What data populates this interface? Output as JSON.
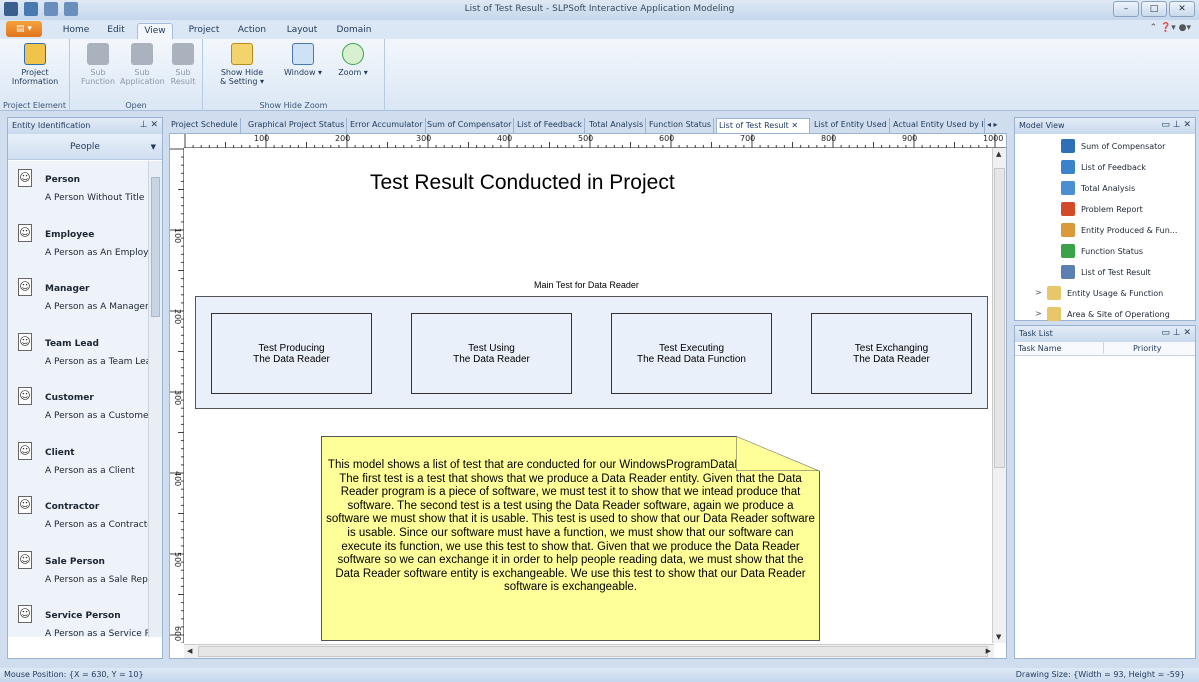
{
  "window": {
    "title": "List of Test Result - SLPSoft Interactive Application Modeling"
  },
  "ribbon": {
    "tabs": [
      "Home",
      "Edit",
      "View",
      "Project",
      "Action",
      "Layout",
      "Domain"
    ],
    "active_tab": "View",
    "groups": [
      {
        "label": "Project Element",
        "buttons": [
          {
            "label": "Project Information"
          }
        ]
      },
      {
        "label": "Open",
        "buttons": [
          {
            "label": "Sub Function"
          },
          {
            "label": "Sub Application"
          },
          {
            "label": "Sub Result"
          }
        ]
      },
      {
        "label": "Show Hide Zoom",
        "buttons": [
          {
            "label": "Show Hide & Setting"
          },
          {
            "label": "Window"
          },
          {
            "label": "Zoom"
          }
        ]
      }
    ]
  },
  "entity_panel": {
    "title": "Entity Identification",
    "category": "People",
    "items": [
      {
        "name": "Person",
        "desc": "A Person Without Title"
      },
      {
        "name": "Employee",
        "desc": "A Person as An Employee"
      },
      {
        "name": "Manager",
        "desc": "A Person as A Manager"
      },
      {
        "name": "Team Lead",
        "desc": "A Person as a Team Lead"
      },
      {
        "name": "Customer",
        "desc": "A Person as a Customer"
      },
      {
        "name": "Client",
        "desc": "A Person as a Client"
      },
      {
        "name": "Contractor",
        "desc": "A Person as a Contractor"
      },
      {
        "name": "Sale Person",
        "desc": "A Person as a Sale Rep"
      },
      {
        "name": "Service Person",
        "desc": "A Person as a Service Re"
      }
    ]
  },
  "doc_tabs": [
    "Project Schedule",
    "Graphical Project Status",
    "Error Accumulator",
    "Sum of Compensator",
    "List of Feedback",
    "Total Analysis",
    "Function Status",
    "List of Test Result",
    "List of Entity Used",
    "Actual Entity Used by I"
  ],
  "active_doc_tab": "List of Test Result",
  "ruler": {
    "h_labels": [
      "100",
      "200",
      "300",
      "400",
      "500",
      "600",
      "700",
      "800",
      "900",
      "1000"
    ],
    "v_labels": [
      "100",
      "200",
      "300",
      "400",
      "500",
      "600"
    ]
  },
  "diagram": {
    "title": "Test Result Conducted in Project",
    "group_label": "Main Test for Data Reader",
    "tests": [
      {
        "line1": "Test Producing",
        "line2": "The Data Reader"
      },
      {
        "line1": "Test Using",
        "line2": "The Data Reader"
      },
      {
        "line1": "Test Executing",
        "line2": "The Read Data Function"
      },
      {
        "line1": "Test Exchanging",
        "line2": "The Data Reader"
      }
    ],
    "note": "This model shows a list of test that are conducted for our WindowsProgramDataReader project.  The first test is a test that shows that we produce a Data Reader entity.  Given that the Data Reader program is a piece of software, we must test it to show that we intead produce that software.  The second test is a test using the Data Reader software, again we produce a software we must show that it is usable.  This test is used to show that our Data Reader software is usable.  Since our software must have a function, we must show that our software can execute its function, we use this test to show that.  Given that we produce the Data Reader software so we can exchange it in order to help people reading data, we must show that the Data Reader software entity is exchangeable.  We use this test to show that our Data Reader software is exchangeable."
  },
  "model_view": {
    "title": "Model View",
    "items": [
      {
        "label": "Sum of Compensator",
        "icon": "sum-icon",
        "color": "#2f6fb8"
      },
      {
        "label": "List of Feedback",
        "icon": "feedback-icon",
        "color": "#3a82c9"
      },
      {
        "label": "Total Analysis",
        "icon": "analysis-icon",
        "color": "#4a8fd1"
      },
      {
        "label": "Problem Report",
        "icon": "problem-icon",
        "color": "#d24a2a"
      },
      {
        "label": "Entity Produced & Fun...",
        "icon": "entity-icon",
        "color": "#d99b3a"
      },
      {
        "label": "Function Status",
        "icon": "function-icon",
        "color": "#3aa34a"
      },
      {
        "label": "List of Test Result",
        "icon": "test-result-icon",
        "color": "#5b7fb0"
      }
    ],
    "folders": [
      {
        "label": "Entity Usage & Function"
      },
      {
        "label": "Area & Site of Operationg"
      }
    ]
  },
  "task_list": {
    "title": "Task List",
    "col_name": "Task Name",
    "col_priority": "Priority"
  },
  "status": {
    "mouse": "Mouse Position: {X = 630,  Y = 10}",
    "drawing": "Drawing Size: {Width = 93, Height = -59}"
  }
}
